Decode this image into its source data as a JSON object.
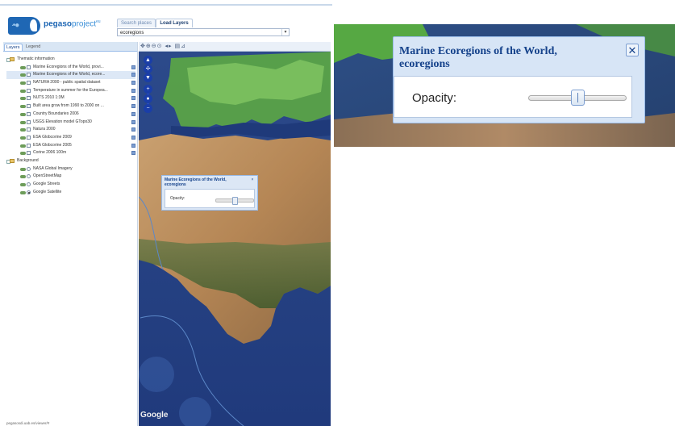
{
  "app": {
    "brand": "pegaso",
    "brand_suffix": "project",
    "brand_sup": "eu"
  },
  "top_tabs": {
    "search": "Search places",
    "load": "Load Layers"
  },
  "search": {
    "value": "ecoregions"
  },
  "side_tabs": {
    "layers": "Layers",
    "legend": "Legend"
  },
  "tree": {
    "thematic_group": "Thematic information",
    "background_group": "Background",
    "thematic_layers": [
      {
        "label": "Marine Ecoregions of the World, provi...",
        "checked": true
      },
      {
        "label": "Marine Ecoregions of the World, ecore...",
        "checked": true
      },
      {
        "label": "NATURA 2000 - public spatial dataset",
        "checked": true
      },
      {
        "label": "Temperature in summer for the Europea...",
        "checked": false
      },
      {
        "label": "NUTS 2010 1:3M",
        "checked": false
      },
      {
        "label": "Built area grow from 1990 to 2000 on ...",
        "checked": false
      },
      {
        "label": "Country Boundaries 2006",
        "checked": false
      },
      {
        "label": "USGS Elevation model GTopo30",
        "checked": false
      },
      {
        "label": "Natura 2000",
        "checked": false
      },
      {
        "label": "ESA Globcorine 2009",
        "checked": false
      },
      {
        "label": "ESA Globcorine 2005",
        "checked": false
      },
      {
        "label": "Corine 2006 100m",
        "checked": false
      }
    ],
    "background_layers": [
      {
        "label": "NASA Global Imagery",
        "selected": false
      },
      {
        "label": "OpenStreetMap",
        "selected": false
      },
      {
        "label": "Google Streets",
        "selected": false
      },
      {
        "label": "Google Satellite",
        "selected": true
      }
    ]
  },
  "status": {
    "url": "pegasosdi.uab.es/viewer/#"
  },
  "map": {
    "toolbar_icons": [
      "pan-icon",
      "zoom-in-icon",
      "zoom-out-icon",
      "zoom-extent-icon",
      "back-icon",
      "forward-icon",
      "print-icon",
      "measure-icon"
    ],
    "attribution": "Google"
  },
  "popup": {
    "title": "Marine Ecoregions of the World, ecoregions",
    "opacity_label": "Opacity:",
    "opacity_value": 0.5
  },
  "colors": {
    "brand_blue": "#1f67b4",
    "panel_header": "#15428b",
    "panel_bg": "#dce7f5"
  }
}
